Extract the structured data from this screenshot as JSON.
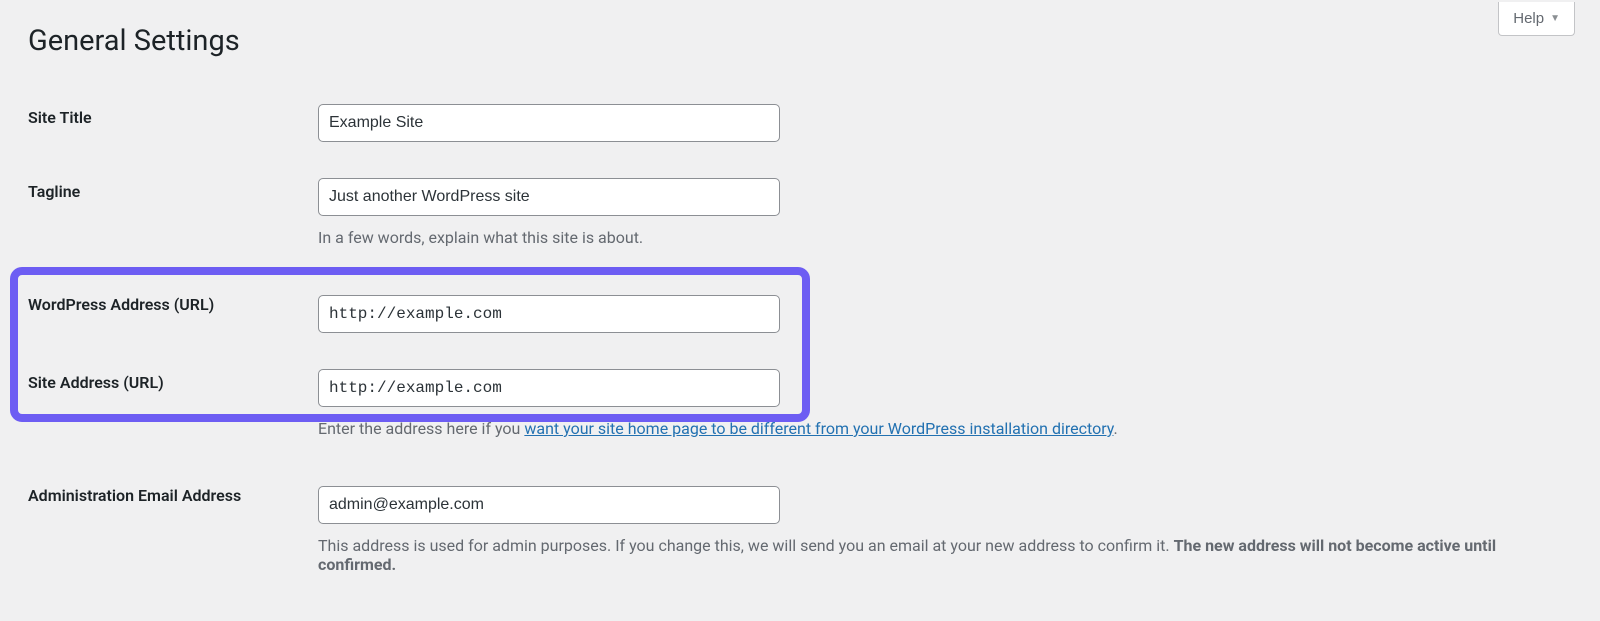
{
  "help": {
    "label": "Help"
  },
  "page": {
    "title": "General Settings"
  },
  "fields": {
    "site_title": {
      "label": "Site Title",
      "value": "Example Site"
    },
    "tagline": {
      "label": "Tagline",
      "value": "Just another WordPress site",
      "description": "In a few words, explain what this site is about."
    },
    "wp_address": {
      "label": "WordPress Address (URL)",
      "value": "http://example.com"
    },
    "site_address": {
      "label": "Site Address (URL)",
      "value": "http://example.com",
      "description_pre": "Enter the address here if you ",
      "description_link": "want your site home page to be different from your WordPress installation directory",
      "description_post": "."
    },
    "admin_email": {
      "label": "Administration Email Address",
      "value": "admin@example.com",
      "description_pre": "This address is used for admin purposes. If you change this, we will send you an email at your new address to confirm it. ",
      "description_strong": "The new address will not become active until confirmed."
    }
  }
}
